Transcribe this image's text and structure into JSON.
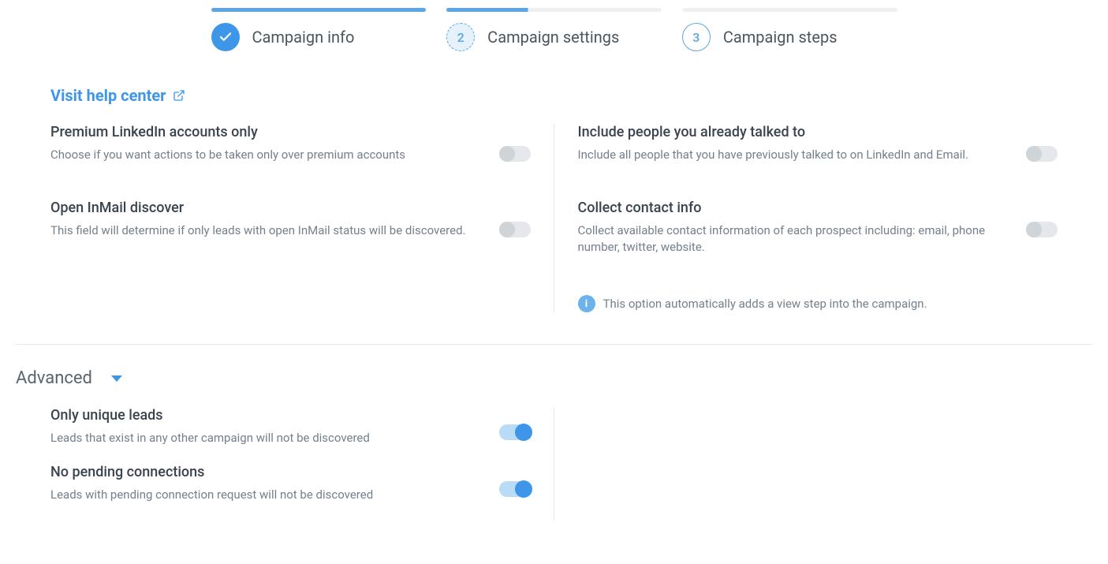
{
  "stepper": {
    "steps": [
      {
        "label": "Campaign info",
        "state": "completed"
      },
      {
        "label": "Campaign settings",
        "state": "active",
        "number": "2"
      },
      {
        "label": "Campaign steps",
        "state": "upcoming",
        "number": "3"
      }
    ]
  },
  "help_link": {
    "label": "Visit help center"
  },
  "settings": {
    "left": [
      {
        "title": "Premium LinkedIn accounts only",
        "desc": "Choose if you want actions to be taken only over premium accounts",
        "on": false
      },
      {
        "title": "Open InMail discover",
        "desc": "This field will determine if only leads with open InMail status will be discovered.",
        "on": false
      }
    ],
    "right": [
      {
        "title": "Include people you already talked to",
        "desc": "Include all people that you have previously talked to on LinkedIn and Email.",
        "on": false
      },
      {
        "title": "Collect contact info",
        "desc": "Collect available contact information of each prospect including: email, phone number, twitter, website.",
        "on": false
      }
    ],
    "info_note": "This option automatically adds a view step into the campaign."
  },
  "advanced": {
    "heading": "Advanced",
    "items": [
      {
        "title": "Only unique leads",
        "desc": "Leads that exist in any other campaign will not be discovered",
        "on": true
      },
      {
        "title": "No pending connections",
        "desc": "Leads with pending connection request will not be discovered",
        "on": true
      }
    ]
  }
}
